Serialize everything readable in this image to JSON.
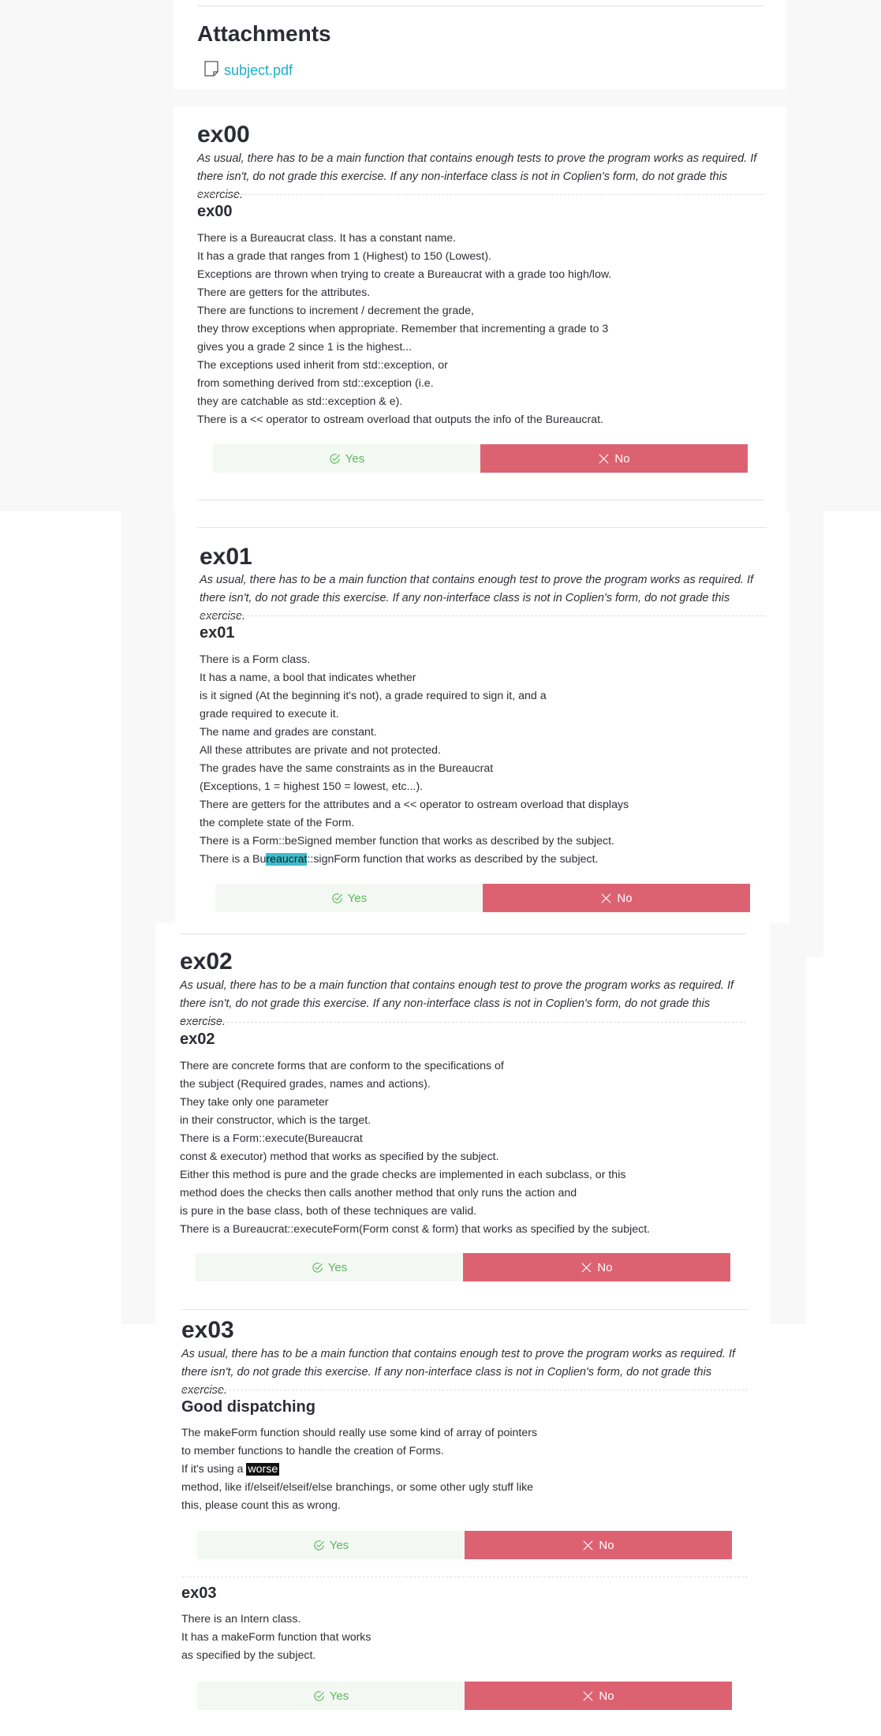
{
  "attachments": {
    "title": "Attachments",
    "file_name": "subject.pdf"
  },
  "buttons": {
    "yes_label": "Yes",
    "no_label": "No"
  },
  "ex00": {
    "title": "ex00",
    "intro": "As usual, there has to be a main function that contains enough tests to prove the program works as required. If there isn't, do not grade this exercise. If any non-interface class is not in Coplien's form, do not grade this exercise.",
    "sub_title": "ex00",
    "lines": [
      "There is a Bureaucrat class. It has a constant name.",
      "It has a grade that ranges from 1 (Highest) to 150 (Lowest).",
      "Exceptions are thrown when trying to create a Bureaucrat with a grade too high/low.",
      "There are getters for the attributes.",
      "There are functions to increment / decrement the grade,",
      "they throw exceptions when appropriate. Remember that incrementing a grade to 3",
      "gives you a grade 2 since 1 is the highest...",
      "The exceptions used inherit from std::exception, or",
      "from something derived from std::exception (i.e.",
      "they are catchable as std::exception & e).",
      "There is a << operator to ostream overload that outputs the info of the Bureaucrat."
    ]
  },
  "ex01": {
    "title": "ex01",
    "intro": "As usual, there has to be a main function that contains enough test to prove the program works as required. If there isn't, do not grade this exercise. If any non-interface class is not in Coplien's form, do not grade this exercise.",
    "sub_title": "ex01",
    "lines": [
      "There is a Form class.",
      "It has a name, a bool that indicates whether",
      "is it signed (At the beginning it's not), a grade required to sign it, and a",
      "grade required to execute it.",
      "The name and grades are constant.",
      "All these attributes are private and not protected.",
      "The grades have the same constraints as in the Bureaucrat",
      "(Exceptions, 1 = highest 150 = lowest, etc...).",
      "There are getters for the attributes and a << operator to ostream overload that displays",
      "the complete state of the Form.",
      "There is a Form::beSigned member function that works as described by the subject."
    ],
    "last_line": {
      "before": "There is a Bu",
      "highlight": "reaucrat",
      "after": "::signForm function that works as described by the subject."
    }
  },
  "ex02": {
    "title": "ex02",
    "intro": "As usual, there has to be a main function that contains enough test to prove the program works as required. If there isn't, do not grade this exercise. If any non-interface class is not in Coplien's form, do not grade this exercise.",
    "sub_title": "ex02",
    "lines": [
      "There are concrete forms that are conform to the specifications of",
      "the subject (Required grades, names and actions).",
      "They take only one parameter",
      "in their constructor, which is the target.",
      "There is a Form::execute(Bureaucrat",
      "const & executor) method that works as specified by the subject.",
      "Either this method is pure and the grade checks are implemented in each subclass, or this",
      "method does the checks then calls another method that only runs the action and",
      "is pure in the base class, both of these techniques are valid.",
      "There is a Bureaucrat::executeForm(Form const & form) that works as specified by the subject."
    ]
  },
  "ex03": {
    "title": "ex03",
    "intro": "As usual, there has to be a main function that contains enough test to prove the program works as required. If there isn't, do not grade this exercise. If any non-interface class is not in Coplien's form, do not grade this exercise.",
    "dispatch_title": "Good dispatching",
    "dispatch_lines_a": [
      "The makeForm function should really use some kind of array of pointers",
      "to member functions to handle the creation of Forms."
    ],
    "dispatch_line_c_before": "If it's using a ",
    "dispatch_line_c_highlight": "worse",
    "dispatch_lines_b": [
      "method, like if/elseif/elseif/else branchings, or some other ugly stuff like",
      "this, please count this as wrong."
    ],
    "sub_title": "ex03",
    "lines": [
      "There is an Intern class.",
      "It has a makeForm function that works",
      "as specified by the subject."
    ]
  },
  "colors": {
    "yes_bg": "#f3f8f2",
    "yes_text": "#5cb85c",
    "no_bg": "#dd6271",
    "link": "#1ab0c8",
    "highlight": "#40bccc"
  },
  "icons": {
    "file": "file-icon",
    "check": "check-circle-icon",
    "cross": "cross-icon"
  }
}
